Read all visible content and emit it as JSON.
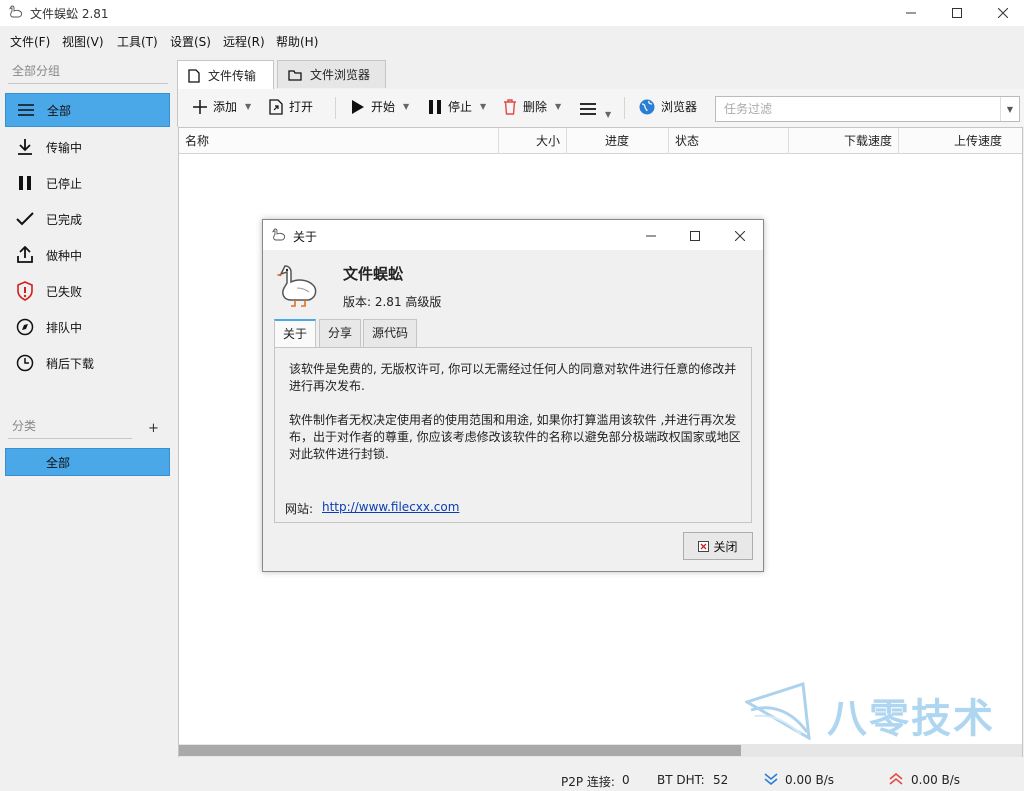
{
  "window": {
    "title": "文件蜈蚣 2.81"
  },
  "menu": [
    "文件(F)",
    "视图(V)",
    "工具(T)",
    "设置(S)",
    "远程(R)",
    "帮助(H)"
  ],
  "sidebar": {
    "groups_heading": "全部分组",
    "groups": [
      {
        "label": "全部",
        "icon": "list-icon",
        "selected": true
      },
      {
        "label": "传输中",
        "icon": "download-icon"
      },
      {
        "label": "已停止",
        "icon": "pause-icon"
      },
      {
        "label": "已完成",
        "icon": "check-icon"
      },
      {
        "label": "做种中",
        "icon": "upload-icon"
      },
      {
        "label": "已失败",
        "icon": "shield-alert-icon"
      },
      {
        "label": "排队中",
        "icon": "compass-icon"
      },
      {
        "label": "稍后下载",
        "icon": "clock-icon"
      }
    ],
    "categories_heading": "分类",
    "categories_add": "+",
    "categories": [
      {
        "label": "全部",
        "selected": true
      }
    ]
  },
  "tabs": [
    {
      "label": "文件传输",
      "icon": "document-icon",
      "active": true
    },
    {
      "label": "文件浏览器",
      "icon": "folder-icon",
      "active": false
    }
  ],
  "toolbar": {
    "add": "添加",
    "open": "打开",
    "start": "开始",
    "stop": "停止",
    "delete": "删除",
    "browser": "浏览器",
    "filter_placeholder": "任务过滤"
  },
  "table": {
    "columns": [
      "名称",
      "大小",
      "进度",
      "状态",
      "下载速度",
      "上传速度"
    ],
    "rows": []
  },
  "status": {
    "p2p_label": "P2P 连接:",
    "p2p_value": "0",
    "dht_label": "BT DHT:",
    "dht_value": "52",
    "down_speed": "0.00 B/s",
    "up_speed": "0.00 B/s"
  },
  "dialog": {
    "title": "关于",
    "app_name": "文件蜈蚣",
    "version": "版本: 2.81 高级版",
    "tabs": [
      "关于",
      "分享",
      "源代码"
    ],
    "paragraph1": "该软件是免费的, 无版权许可, 你可以无需经过任何人的同意对软件进行任意的修改并进行再次发布.",
    "paragraph2": "软件制作者无权决定使用者的使用范围和用途, 如果你打算滥用该软件 ,并进行再次发布，出于对作者的尊重, 你应该考虑修改该软件的名称以避免部分极端政权国家或地区对此软件进行封锁.",
    "site_label": "网站:",
    "site_url": "http://www.filecxx.com",
    "close_label": "关闭"
  },
  "watermark": {
    "text": "八零技术"
  },
  "colors": {
    "accent": "#4aa7e8",
    "link": "#0a3fb0",
    "delete_red": "#e04a4a",
    "up_red": "#e04a4a",
    "down_blue": "#2a7fd4"
  }
}
